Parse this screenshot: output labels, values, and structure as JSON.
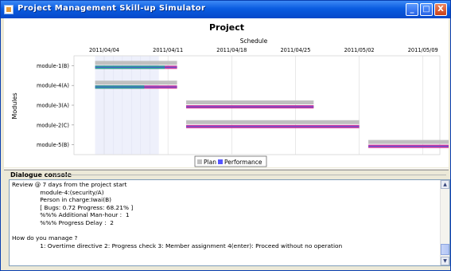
{
  "window": {
    "title": "Project Management Skill-up Simulator",
    "controls": {
      "minimize": "_",
      "maximize": "□",
      "close": "X"
    }
  },
  "chart_data": {
    "type": "gantt",
    "title": "Project",
    "subtitle": "Schedule",
    "ylabel": "Modules",
    "x_ticks": [
      "2011/04/04",
      "2011/04/11",
      "2011/04/18",
      "2011/04/25",
      "2011/05/02",
      "2011/05/09"
    ],
    "x_range": [
      "2011/04/04",
      "2011/05/13"
    ],
    "rows": [
      {
        "module": "module-1(B)",
        "plan": [
          "2011/04/03",
          "2011/04/12"
        ],
        "performance": [
          "2011/04/03",
          "2011/04/12"
        ],
        "performance_progress": 0.85
      },
      {
        "module": "module-4(A)",
        "plan": [
          "2011/04/03",
          "2011/04/12"
        ],
        "performance": [
          "2011/04/03",
          "2011/04/12"
        ],
        "performance_progress": 0.6
      },
      {
        "module": "module-3(A)",
        "plan": [
          "2011/04/13",
          "2011/04/27"
        ],
        "performance": [
          "2011/04/13",
          "2011/04/27"
        ],
        "performance_progress": 0
      },
      {
        "module": "module-2(C)",
        "plan": [
          "2011/04/13",
          "2011/05/02"
        ],
        "performance": [
          "2011/04/13",
          "2011/05/02"
        ],
        "performance_progress": 0
      },
      {
        "module": "module-5(B)",
        "plan": [
          "2011/05/03",
          "2011/05/12"
        ],
        "performance": [
          "2011/05/03",
          "2011/05/12"
        ],
        "performance_progress": 0
      }
    ],
    "highlight_range": [
      "2011/04/03",
      "2011/04/10"
    ],
    "legend": [
      {
        "name": "Plan",
        "color": "#c0c0c0"
      },
      {
        "name": "Performance",
        "color": "#5555ff"
      }
    ],
    "legend_position": "bottom",
    "colors": {
      "plan": "#c0c0c0",
      "performance": "#c8349a",
      "progress": "#21a38e",
      "performance_stripe": "#5a5ad8"
    }
  },
  "console": {
    "label": "Dialogue console",
    "lines": [
      "Review @ 7 days from the project start",
      "               module-4:(security/A)",
      "               Person in charge:Iwai(B)",
      "               [ Bugs: 0.72 Progress: 68.21% ]",
      "               %%% Additional Man-hour :  1",
      "               %%% Progress Delay :  2",
      "",
      "How do you manage ?",
      "               1: Overtime directive 2: Progress check 3: Member assignment 4(enter): Proceed without no operation"
    ],
    "scroll_up": "▲",
    "scroll_down": "▼"
  }
}
